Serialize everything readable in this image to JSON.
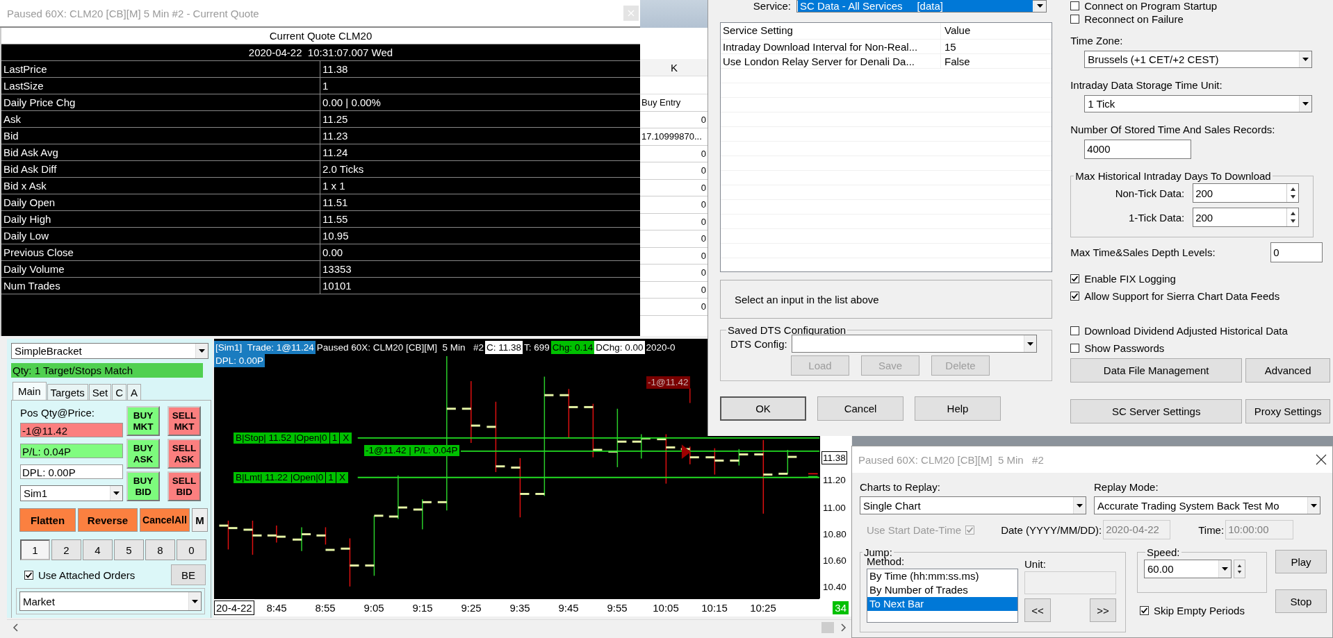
{
  "quote_window": {
    "title": "Paused 60X: CLM20 [CB][M]  5 Min   #2 - Current Quote",
    "heading": "Current Quote  CLM20",
    "timestamp": "2020-04-22  10:31:07.007 Wed",
    "rows": [
      {
        "label": "LastPrice",
        "value": "11.38"
      },
      {
        "label": "LastSize",
        "value": "1"
      },
      {
        "label": "Daily Price Chg",
        "value": "0.00 | 0.00%"
      },
      {
        "label": "Ask",
        "value": "11.25"
      },
      {
        "label": "Bid",
        "value": "11.23"
      },
      {
        "label": "Bid Ask Avg",
        "value": "11.24"
      },
      {
        "label": "Bid Ask Diff",
        "value": "2.0 Ticks"
      },
      {
        "label": "Bid x Ask",
        "value": "1 x 1"
      },
      {
        "label": "Daily Open",
        "value": "11.51"
      },
      {
        "label": "Daily High",
        "value": "11.55"
      },
      {
        "label": "Daily Low",
        "value": "10.95"
      },
      {
        "label": "Previous Close",
        "value": "0.00"
      },
      {
        "label": "Daily Volume",
        "value": "13353"
      },
      {
        "label": "Num Trades",
        "value": "10101"
      }
    ]
  },
  "spreadsheet": {
    "column_header": "K",
    "cells": [
      "Buy Entry",
      "0",
      "17.10999870...",
      "0",
      "0",
      "0",
      "0",
      "0",
      "0",
      "0",
      "0",
      "0",
      "0"
    ]
  },
  "data_settings": {
    "service": {
      "label": "Service:",
      "value": "SC Data - All Services     [data]"
    },
    "settings_table": {
      "columns": [
        "Service Setting",
        "Value"
      ],
      "rows": [
        {
          "setting": "Intraday Download Interval for Non-Real...",
          "value": "15"
        },
        {
          "setting": "Use London Relay Server for Denali Da...",
          "value": "False"
        }
      ]
    },
    "hint": "Select an input in the list above",
    "dts": {
      "title": "Saved DTS Configuration",
      "label": "DTS Config:",
      "buttons": [
        {
          "label": "Load",
          "disabled": true
        },
        {
          "label": "Save",
          "disabled": true
        },
        {
          "label": "Delete",
          "disabled": true
        }
      ]
    },
    "dialog_buttons": [
      {
        "label": "OK",
        "default": true
      },
      {
        "label": "Cancel",
        "default": false
      },
      {
        "label": "Help",
        "default": false
      }
    ],
    "startup_options": [
      {
        "label": "Connect on Program Startup",
        "checked": false
      },
      {
        "label": "Reconnect on Failure",
        "checked": false
      }
    ],
    "time_zone": {
      "label": "Time Zone:",
      "value": "Brussels (+1 CET/+2 CEST)"
    },
    "storage_unit": {
      "label": "Intraday Data Storage Time Unit:",
      "value": "1 Tick"
    },
    "stored_records": {
      "label": "Number Of Stored Time And Sales Records:",
      "value": "4000"
    },
    "max_days": {
      "title": "Max Historical Intraday Days To Download",
      "fields": [
        {
          "label": "Non-Tick Data:",
          "value": "200"
        },
        {
          "label": "1-Tick Data:",
          "value": "200"
        }
      ]
    },
    "depth_levels": {
      "label": "Max Time&Sales Depth Levels:",
      "value": "0"
    },
    "feed_options": [
      {
        "label": "Enable FIX Logging",
        "checked": true
      },
      {
        "label": "Allow Support for Sierra Chart Data Feeds",
        "checked": true
      }
    ],
    "extra_options": [
      {
        "label": "Download Dividend Adjusted Historical Data",
        "checked": false
      },
      {
        "label": "Show Passwords",
        "checked": false
      }
    ],
    "side_buttons": [
      "Data File Management",
      "Advanced",
      "SC Server Settings",
      "Proxy Settings"
    ]
  },
  "trade_panel": {
    "strategy": "SimpleBracket",
    "qty_status": "Qty: 1 Target/Stops Match",
    "tabs": [
      {
        "label": "Main",
        "selected": true
      },
      {
        "label": "Targets",
        "selected": false
      },
      {
        "label": "Set",
        "selected": false
      },
      {
        "label": "C",
        "selected": false
      },
      {
        "label": "A",
        "selected": false
      }
    ],
    "position_label": "Pos Qty@Price:",
    "position": "-1@11.42",
    "pl": "P/L: 0.04P",
    "dpl": "DPL: 0.00P",
    "account": "Sim1",
    "order_buttons": [
      {
        "label": "BUY MKT",
        "color": "#7dfb7d"
      },
      {
        "label": "SELL MKT",
        "color": "#fb7f7f"
      },
      {
        "label": "BUY ASK",
        "color": "#7dfb7d"
      },
      {
        "label": "SELL ASK",
        "color": "#fb7f7f"
      },
      {
        "label": "BUY BID",
        "color": "#7dfb7d"
      },
      {
        "label": "SELL BID",
        "color": "#fb7f7f"
      }
    ],
    "action_buttons": [
      {
        "label": "Flatten",
        "kind": "action"
      },
      {
        "label": "Reverse",
        "kind": "action"
      },
      {
        "label": "CancelAll",
        "kind": "action"
      },
      {
        "label": "M",
        "kind": "plain"
      }
    ],
    "quantity_buttons": [
      {
        "label": "1",
        "selected": true
      },
      {
        "label": "2",
        "selected": false
      },
      {
        "label": "4",
        "selected": false
      },
      {
        "label": "5",
        "selected": false
      },
      {
        "label": "8",
        "selected": false
      },
      {
        "label": "0",
        "selected": false
      }
    ],
    "attached_orders": {
      "label": "Use Attached Orders",
      "checked": true
    },
    "be_button": "BE",
    "order_type": "Market"
  },
  "chart": {
    "header": [
      {
        "text": "[Sim1]  Trade: 1@11.24",
        "kind": "account"
      },
      {
        "text": "Paused 60X: CLM20 [CB][M]  5 Min   #2",
        "kind": "plain"
      },
      {
        "text": "C: 11.38",
        "kind": "highlight"
      },
      {
        "text": "T: 699",
        "kind": "plain"
      },
      {
        "text": "Chg: 0.14",
        "kind": "change"
      },
      {
        "text": "DChg: 0.00",
        "kind": "highlight"
      },
      {
        "text": "2020-0",
        "kind": "plain"
      }
    ],
    "dpl_badge": "DPL: 0.00P",
    "order_lines": [
      {
        "label": "B|Stop| 11.52 |Open|0",
        "qty": "1",
        "cancel": "X",
        "kind": "stop"
      },
      {
        "label": "B|Lmt| 11.22 |Open|0",
        "qty": "1",
        "cancel": "X",
        "kind": "limit"
      }
    ],
    "position_line": "-1@11.42 | P/L: 0.04P",
    "fill_marker": "-1@11.42",
    "price_labels": [
      {
        "text": "11.38",
        "current": true
      },
      {
        "text": "11.20",
        "current": false
      },
      {
        "text": "11.00",
        "current": false
      },
      {
        "text": "10.80",
        "current": false
      },
      {
        "text": "10.60",
        "current": false
      },
      {
        "text": "10.40",
        "current": false
      }
    ],
    "date_label": "20-4-22",
    "time_labels": [
      "8:45",
      "8:55",
      "9:05",
      "9:15",
      "9:25",
      "9:35",
      "9:45",
      "9:55",
      "10:05",
      "10:15",
      "10:25"
    ],
    "bar_count": "34"
  },
  "replay_dialog": {
    "title": "Paused 60X: CLM20 [CB][M]  5 Min   #2",
    "charts_label": "Charts to Replay:",
    "charts_value": "Single Chart",
    "mode_label": "Replay Mode:",
    "mode_value": "Accurate Trading System Back Test Mo",
    "start": {
      "label": "Use Start Date-Time",
      "checked": true,
      "disabled": true
    },
    "date_label": "Date (YYYY/MM/DD):",
    "date_value": "2020-04-22",
    "time_label": "Time:",
    "time_value": "10:00:00",
    "jump_title": "Jump:",
    "method_label": "Method:",
    "methods": [
      {
        "label": "By Time (hh:mm:ss.ms)",
        "selected": false
      },
      {
        "label": "By Number of Trades",
        "selected": false
      },
      {
        "label": "To Next Bar",
        "selected": true
      }
    ],
    "unit_label": "Unit:",
    "prev": "<<",
    "next": ">>",
    "speed_title": "Speed:",
    "speed_value": "60.00",
    "play": "Play",
    "stop": "Stop",
    "skip_empty": {
      "label": "Skip Empty Periods",
      "checked": true
    }
  }
}
